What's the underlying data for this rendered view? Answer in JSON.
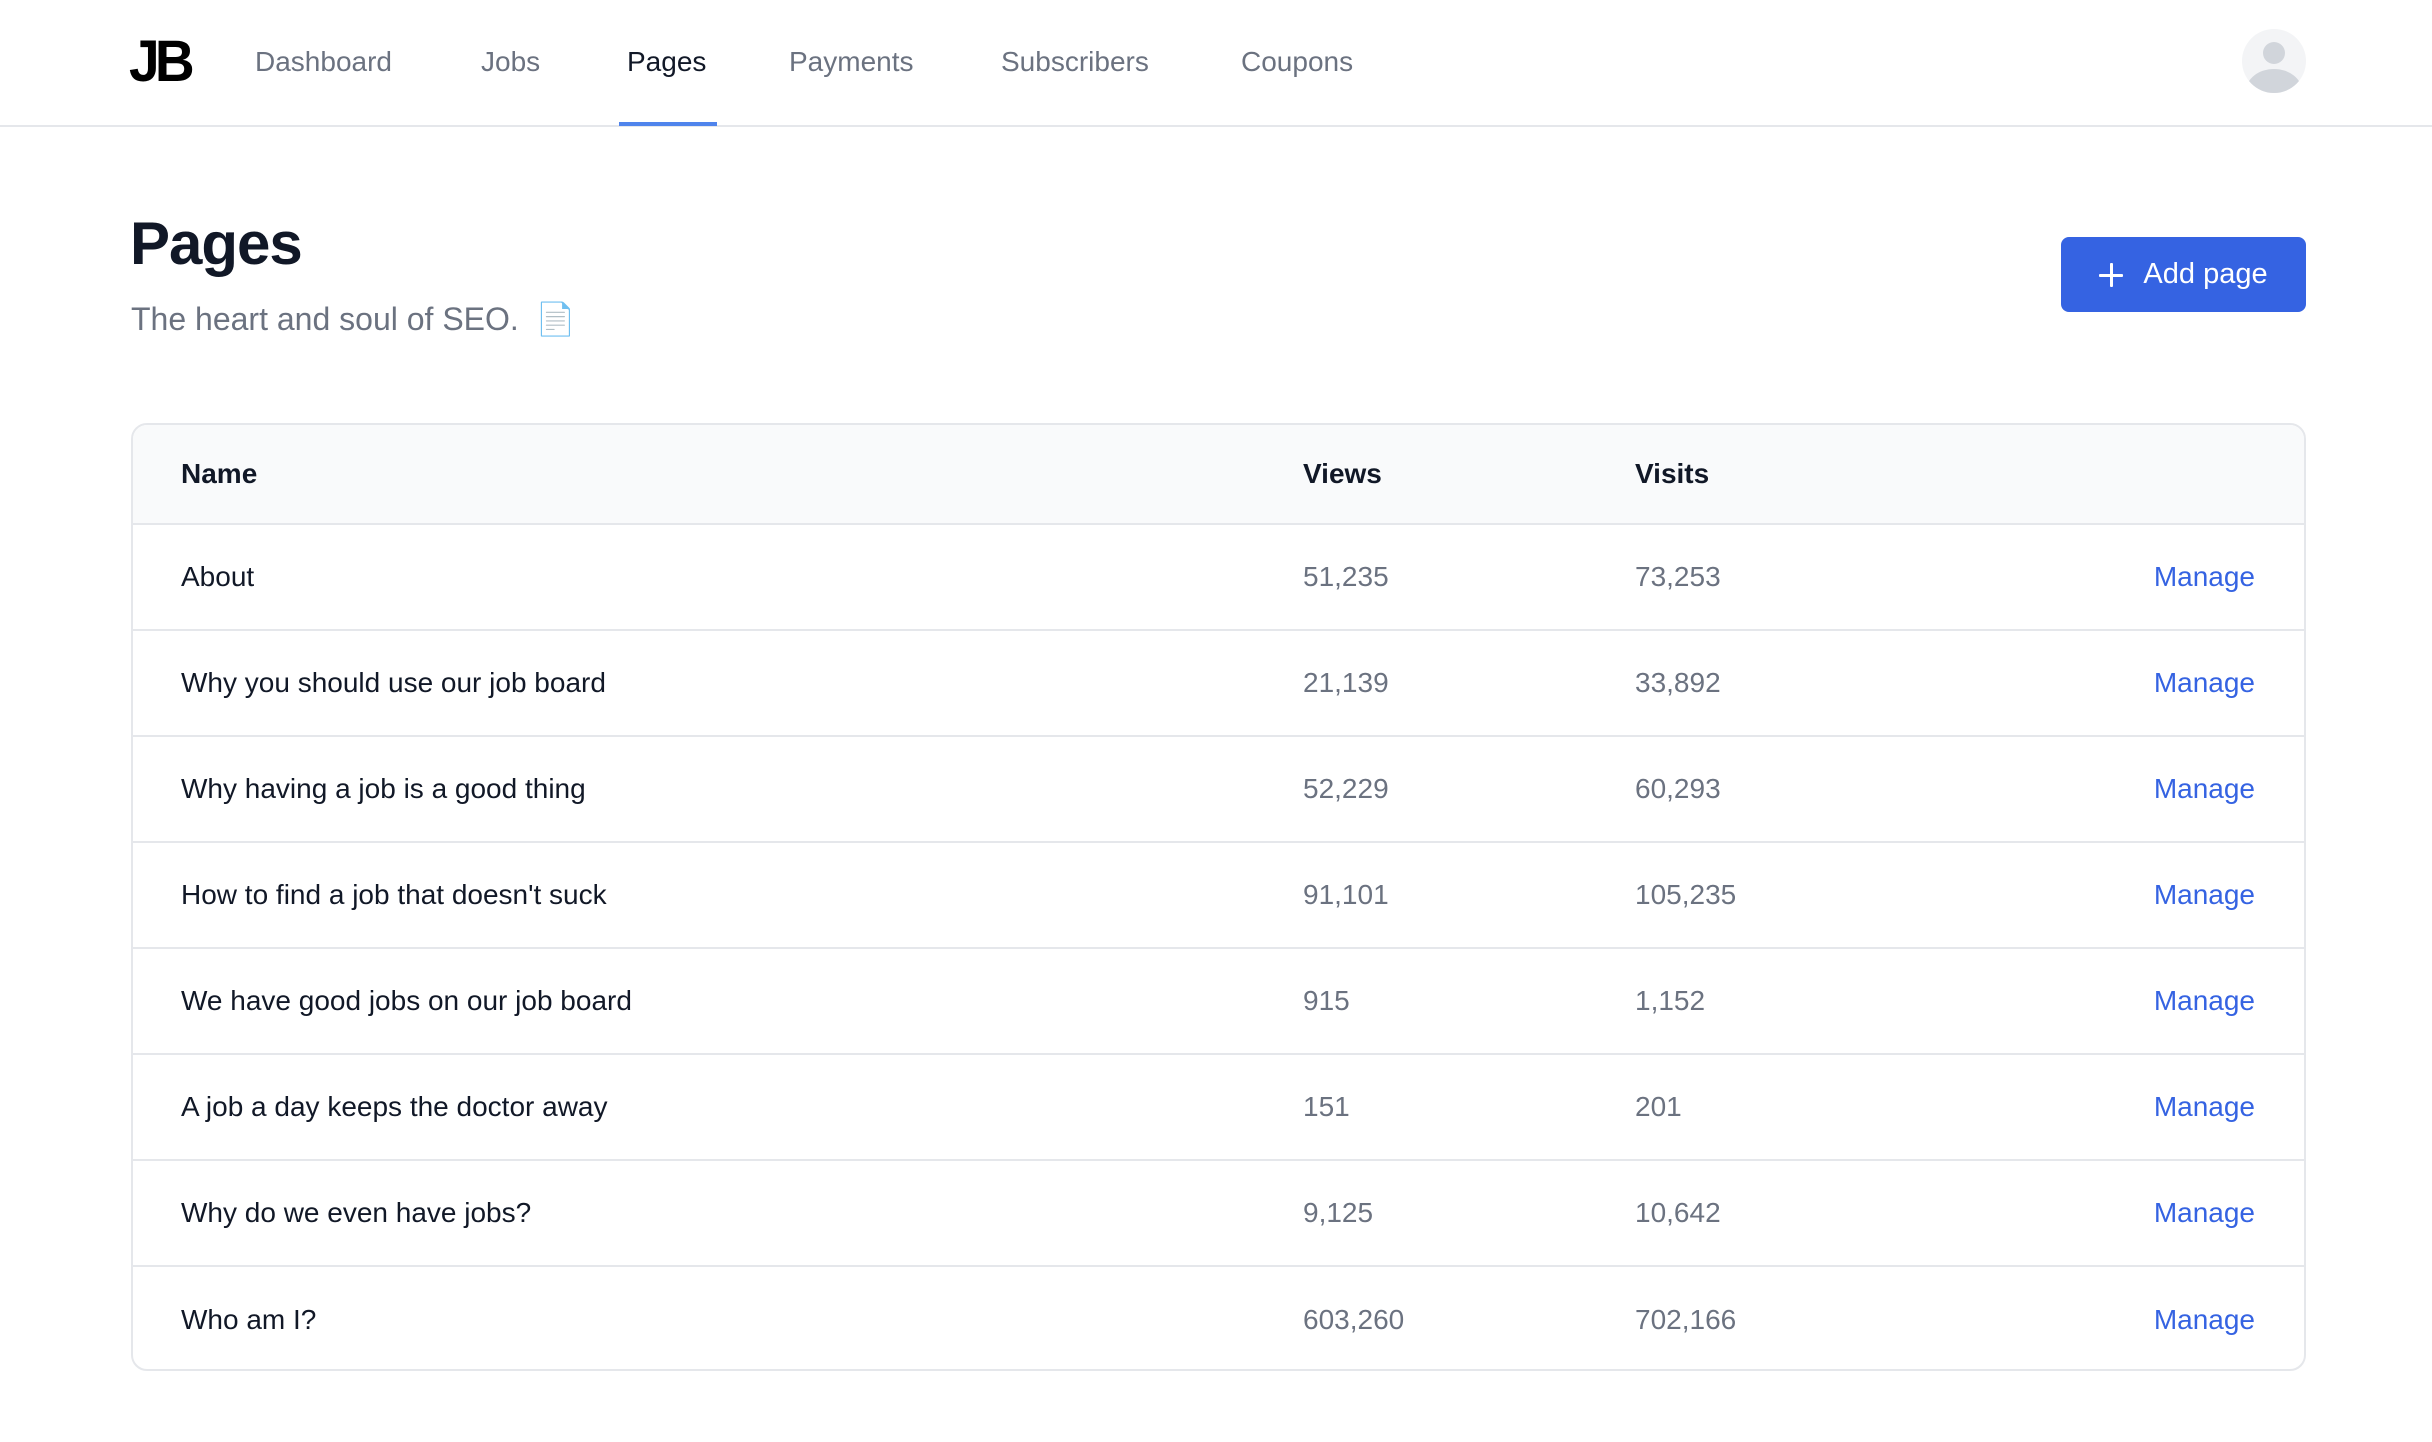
{
  "header": {
    "logo": "JB",
    "nav": [
      {
        "label": "Dashboard",
        "active": false
      },
      {
        "label": "Jobs",
        "active": false
      },
      {
        "label": "Pages",
        "active": true
      },
      {
        "label": "Payments",
        "active": false
      },
      {
        "label": "Subscribers",
        "active": false
      },
      {
        "label": "Coupons",
        "active": false
      }
    ],
    "avatar_icon": "user-avatar-placeholder"
  },
  "page": {
    "title": "Pages",
    "subtitle": "The heart and soul of SEO.",
    "subtitle_emoji": "📄",
    "add_button_label": "Add page",
    "add_button_icon": "plus-icon"
  },
  "table": {
    "columns": [
      "Name",
      "Views",
      "Visits"
    ],
    "action_label": "Manage",
    "rows": [
      {
        "name": "About",
        "views": "51,235",
        "visits": "73,253"
      },
      {
        "name": "Why you should use our job board",
        "views": "21,139",
        "visits": "33,892"
      },
      {
        "name": "Why having a job is a good thing",
        "views": "52,229",
        "visits": "60,293"
      },
      {
        "name": "How to find a job that doesn't suck",
        "views": "91,101",
        "visits": "105,235"
      },
      {
        "name": "We have good jobs on our job board",
        "views": "915",
        "visits": "1,152"
      },
      {
        "name": "A job a day keeps the doctor away",
        "views": "151",
        "visits": "201"
      },
      {
        "name": "Why do we even have jobs?",
        "views": "9,125",
        "visits": "10,642"
      },
      {
        "name": "Who am I?",
        "views": "603,260",
        "visits": "702,166"
      }
    ]
  },
  "colors": {
    "accent": "#3563E2",
    "active_tab_underline": "#4F84EC",
    "text_primary": "#111827",
    "text_muted": "#6B7280",
    "border": "#E5E7EB",
    "table_header_bg": "#F9FAFB"
  }
}
